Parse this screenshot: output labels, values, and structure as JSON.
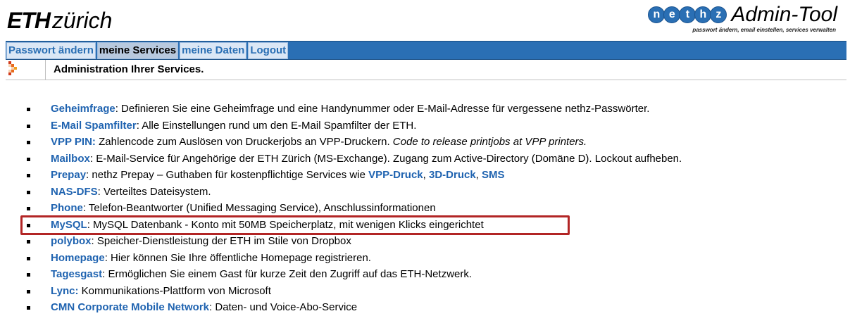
{
  "header": {
    "eth_logo": {
      "eth": "ETH",
      "zurich": "zürich"
    },
    "nethz_logo": {
      "letters": [
        "n",
        "e",
        "t",
        "h",
        "z"
      ],
      "tool_name": "Admin-Tool",
      "tagline": "passwort ändern, email einstellen, services verwalten"
    }
  },
  "nav": {
    "items": [
      {
        "label": "Passwort ändern",
        "active": false
      },
      {
        "label": "meine Services",
        "active": true
      },
      {
        "label": "meine Daten",
        "active": false
      },
      {
        "label": "Logout",
        "active": false
      }
    ]
  },
  "subheader": {
    "title": "Administration Ihrer Services."
  },
  "services": [
    {
      "name": "Geheimfrage",
      "sep": ": ",
      "desc": "Definieren Sie eine Geheimfrage und eine Handynummer oder E-Mail-Adresse für vergessene nethz-Passwörter."
    },
    {
      "name": "E-Mail Spamfilter",
      "sep": ": ",
      "desc": "Alle Einstellungen rund um den E-Mail Spamfilter der ETH."
    },
    {
      "name": "VPP PIN:",
      "sep": " ",
      "desc": "Zahlencode zum Auslösen von Druckerjobs an VPP-Druckern. ",
      "desc_italic": "Code to release printjobs at VPP printers."
    },
    {
      "name": "Mailbox",
      "sep": ": ",
      "desc": "E-Mail-Service für Angehörige der ETH Zürich (MS-Exchange). Zugang zum Active-Directory (Domäne D). Lockout aufheben."
    },
    {
      "name": "Prepay",
      "sep": ": ",
      "desc": "nethz Prepay – Guthaben für kostenpflichtige Services wie ",
      "links": [
        "VPP-Druck",
        "3D-Druck",
        "SMS"
      ]
    },
    {
      "name": "NAS-DFS",
      "sep": ": ",
      "desc": "Verteiltes Dateisystem."
    },
    {
      "name": "Phone",
      "sep": ": ",
      "desc": "Telefon-Beantworter (Unified Messaging Service), Anschlussinformationen"
    },
    {
      "name": "MySQL",
      "sep": ": ",
      "desc": "MySQL Datenbank - Konto mit 50MB Speicherplatz, mit wenigen Klicks eingerichtet"
    },
    {
      "name": "polybox",
      "sep": ": ",
      "desc": "Speicher-Dienstleistung der ETH im Stile von Dropbox"
    },
    {
      "name": "Homepage",
      "sep": ": ",
      "desc": "Hier können Sie Ihre öffentliche Homepage registrieren."
    },
    {
      "name": "Tagesgast",
      "sep": ": ",
      "desc": "Ermöglichen Sie einem Gast für kurze Zeit den Zugriff auf das ETH-Netzwerk."
    },
    {
      "name": "Lync:",
      "sep": " ",
      "desc": "Kommunikations-Plattform von Microsoft"
    },
    {
      "name": "CMN Corporate Mobile Network",
      "sep": ": ",
      "desc": "Daten- und Voice-Abo-Service"
    }
  ],
  "link_sep": ", ",
  "colors": {
    "nav_bar": "#2a6fb4",
    "link": "#1f63b0",
    "highlight": "#b22525"
  }
}
